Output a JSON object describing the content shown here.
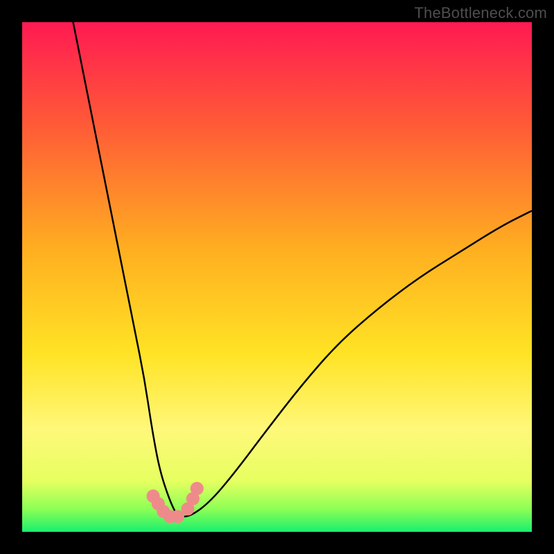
{
  "watermark": "TheBottleneck.com",
  "chart_data": {
    "type": "line",
    "title": "",
    "xlabel": "",
    "ylabel": "",
    "xlim": [
      0,
      100
    ],
    "ylim": [
      0,
      100
    ],
    "grid": false,
    "legend": false,
    "gradient_stops": [
      {
        "offset": 0.0,
        "color": "#ff1a52"
      },
      {
        "offset": 0.2,
        "color": "#ff5a37"
      },
      {
        "offset": 0.45,
        "color": "#ffb020"
      },
      {
        "offset": 0.65,
        "color": "#ffe325"
      },
      {
        "offset": 0.8,
        "color": "#fff87a"
      },
      {
        "offset": 0.9,
        "color": "#e6ff60"
      },
      {
        "offset": 0.955,
        "color": "#8dff55"
      },
      {
        "offset": 1.0,
        "color": "#19ef6f"
      }
    ],
    "series": [
      {
        "name": "curve",
        "color": "#000000",
        "x": [
          10,
          12,
          14,
          16,
          18,
          20,
          22,
          24,
          25.5,
          27,
          29,
          30.5,
          33,
          37,
          42,
          48,
          55,
          62,
          70,
          78,
          86,
          94,
          100
        ],
        "y": [
          100,
          90,
          80,
          70,
          60,
          50,
          40,
          30,
          20,
          12,
          6,
          3,
          3,
          6,
          12,
          20,
          29,
          37,
          44,
          50,
          55,
          60,
          63
        ]
      }
    ],
    "markers": {
      "color": "#ee8b8a",
      "radius": 1.3,
      "points": [
        {
          "x": 25.7,
          "y": 7.0
        },
        {
          "x": 26.7,
          "y": 5.5
        },
        {
          "x": 27.7,
          "y": 4.0
        },
        {
          "x": 29.0,
          "y": 3.0
        },
        {
          "x": 30.5,
          "y": 3.0
        },
        {
          "x": 32.5,
          "y": 4.5
        },
        {
          "x": 33.5,
          "y": 6.5
        },
        {
          "x": 34.3,
          "y": 8.5
        }
      ]
    }
  }
}
